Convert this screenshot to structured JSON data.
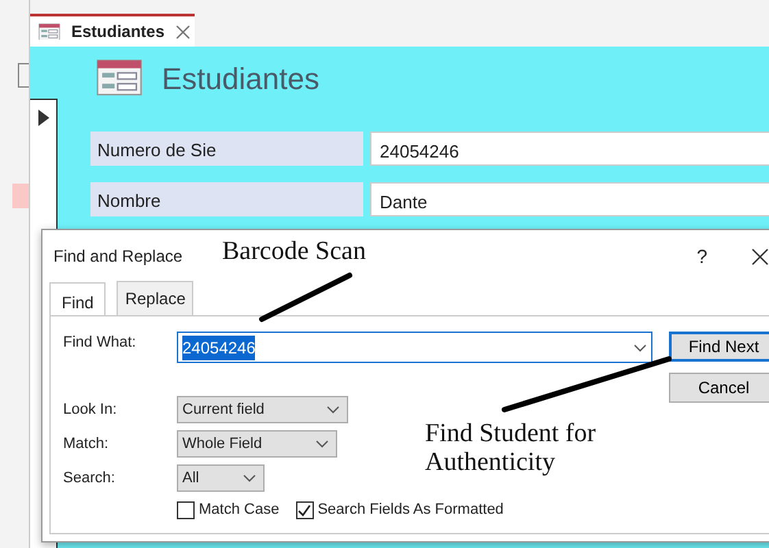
{
  "document_tab": {
    "title": "Estudiantes",
    "selected": true
  },
  "form": {
    "title": "Estudiantes",
    "fields": [
      {
        "label": "Numero de Sie",
        "value": "24054246"
      },
      {
        "label": "Nombre",
        "value": "Dante"
      }
    ]
  },
  "dialog": {
    "title": "Find and Replace",
    "help": "?",
    "tabs": [
      {
        "label": "Find",
        "selected": true
      },
      {
        "label": "Replace",
        "selected": false
      }
    ],
    "find_what": {
      "label": "Find What:",
      "value": "24054246"
    },
    "buttons": [
      {
        "label": "Find Next",
        "default": true
      },
      {
        "label": "Cancel",
        "default": false
      }
    ],
    "options": [
      {
        "label": "Look In:",
        "value": "Current field"
      },
      {
        "label": "Match:",
        "value": "Whole Field"
      },
      {
        "label": "Search:",
        "value": "All"
      }
    ],
    "checkboxes": [
      {
        "label": "Match Case",
        "checked": false
      },
      {
        "label": "Search Fields As Formatted",
        "checked": true
      }
    ]
  },
  "annotations": [
    {
      "text": "Barcode Scan"
    },
    {
      "text": "Find Student for Authenticity"
    }
  ]
}
